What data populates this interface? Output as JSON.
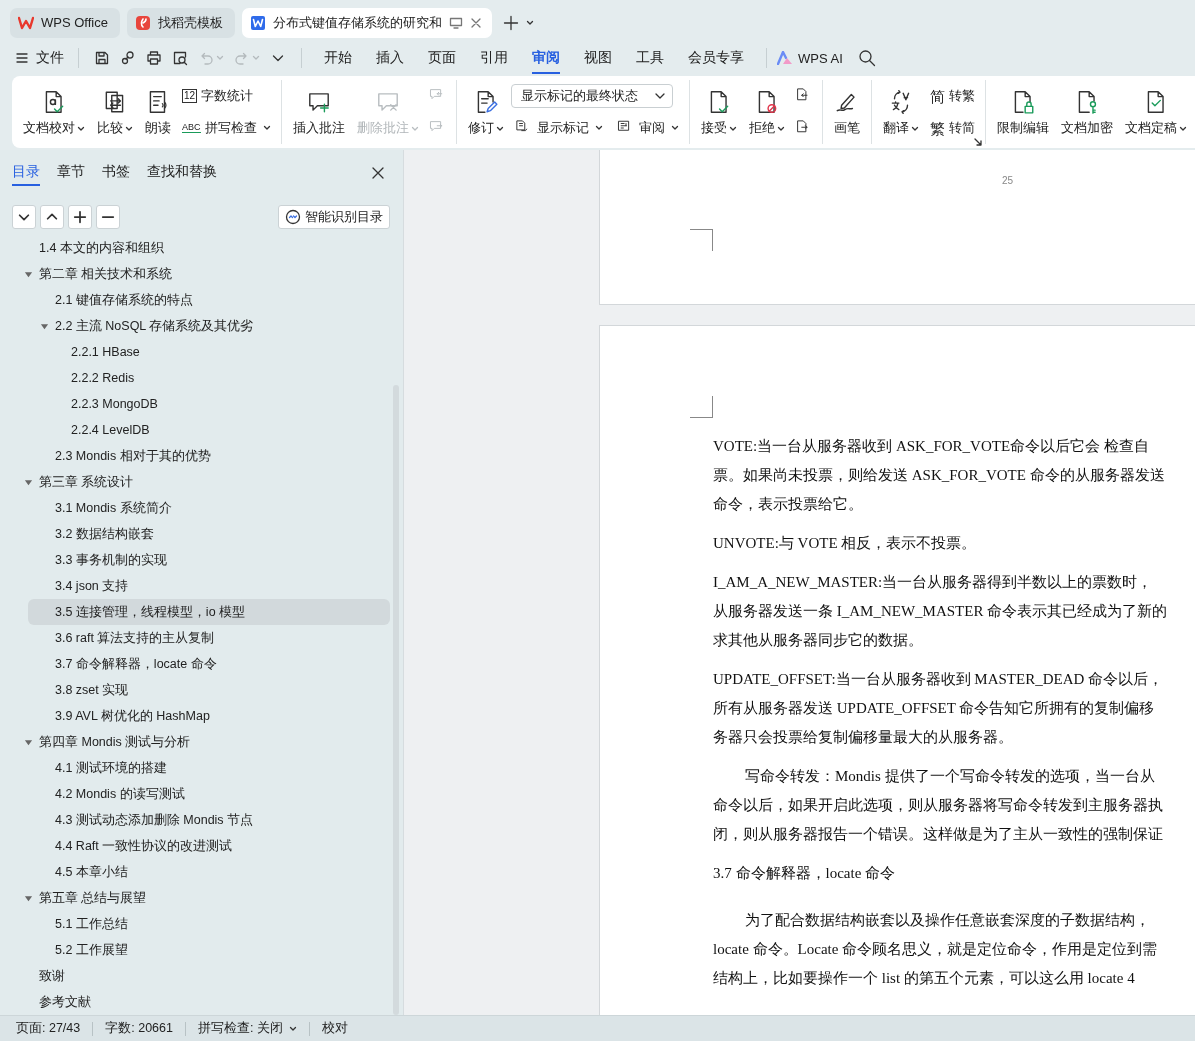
{
  "tab_bar": {
    "tabs": [
      {
        "kind": "home",
        "label": "WPS Office",
        "selected": false
      },
      {
        "kind": "template",
        "label": "找稻壳模板",
        "selected": false
      },
      {
        "kind": "document",
        "label": "分布式键值存储系统的研究和",
        "selected": true
      }
    ]
  },
  "menu_bar": {
    "file_menu": "文件",
    "quick_tools": [
      {
        "kind": "save",
        "disabled": false
      },
      {
        "kind": "link",
        "disabled": false
      },
      {
        "kind": "print",
        "disabled": false
      },
      {
        "kind": "preview",
        "disabled": false
      },
      {
        "kind": "undo",
        "disabled": true
      },
      {
        "kind": "redo",
        "disabled": true
      },
      {
        "kind": "more",
        "disabled": false
      }
    ],
    "tabs": [
      {
        "label": "开始",
        "selected": false
      },
      {
        "label": "插入",
        "selected": false
      },
      {
        "label": "页面",
        "selected": false
      },
      {
        "label": "引用",
        "selected": false
      },
      {
        "label": "审阅",
        "selected": true
      },
      {
        "label": "视图",
        "selected": false
      },
      {
        "label": "工具",
        "selected": false
      },
      {
        "label": "会员专享",
        "selected": false
      }
    ],
    "ai_label": "WPS AI"
  },
  "ribbon": {
    "groups": [
      {
        "columns": [
          {
            "kind": "large",
            "rows": [
              [
                {
                  "kind": "proofread",
                  "label": "文档校对",
                  "dropdown": true,
                  "disabled": false
                }
              ]
            ]
          },
          {
            "kind": "large",
            "rows": [
              [
                {
                  "kind": "compare",
                  "label": "比较",
                  "dropdown": true,
                  "disabled": false
                }
              ]
            ]
          },
          {
            "kind": "large",
            "rows": [
              [
                {
                  "kind": "read",
                  "label": "朗读",
                  "dropdown": false,
                  "disabled": false
                }
              ]
            ]
          },
          {
            "kind": "stack",
            "rows": [
              [
                {
                  "kind": "count",
                  "glyph": "12",
                  "label": "字数统计",
                  "dropdown": false,
                  "disabled": false
                }
              ],
              [
                {
                  "kind": "spell",
                  "glyph": "ABC",
                  "label": "拼写检查",
                  "dropdown": true,
                  "disabled": false
                }
              ]
            ]
          }
        ]
      },
      {
        "columns": [
          {
            "kind": "large",
            "rows": [
              [
                {
                  "kind": "comment",
                  "label": "插入批注",
                  "dropdown": false,
                  "disabled": false
                }
              ]
            ]
          },
          {
            "kind": "large",
            "rows": [
              [
                {
                  "kind": "delete_comment",
                  "label": "删除批注",
                  "dropdown": true,
                  "disabled": true
                }
              ]
            ]
          },
          {
            "kind": "stack",
            "rows": [
              [
                {
                  "kind": "prev_comment",
                  "dropdown": false,
                  "disabled": true
                }
              ],
              [
                {
                  "kind": "next_comment",
                  "dropdown": false,
                  "disabled": true
                }
              ]
            ]
          }
        ]
      },
      {
        "columns": [
          {
            "kind": "large",
            "rows": [
              [
                {
                  "kind": "revise",
                  "label": "修订",
                  "dropdown": true,
                  "disabled": false
                }
              ]
            ]
          },
          {
            "kind": "stack",
            "rows": [
              [
                {
                  "kind": "select",
                  "label": "显示标记的最终状态",
                  "dropdown": true,
                  "disabled": false
                }
              ],
              [
                {
                  "kind": "markup",
                  "label": "显示标记",
                  "dropdown": true,
                  "disabled": false
                },
                {
                  "kind": "review_pane",
                  "label": "审阅",
                  "dropdown": true,
                  "disabled": false
                }
              ]
            ]
          }
        ]
      },
      {
        "columns": [
          {
            "kind": "large",
            "rows": [
              [
                {
                  "kind": "accept",
                  "label": "接受",
                  "dropdown": true,
                  "disabled": false
                }
              ]
            ]
          },
          {
            "kind": "large",
            "rows": [
              [
                {
                  "kind": "reject",
                  "label": "拒绝",
                  "dropdown": true,
                  "disabled": false
                }
              ]
            ]
          },
          {
            "kind": "stack",
            "rows": [
              [
                {
                  "kind": "prev_change",
                  "dropdown": false,
                  "disabled": false
                }
              ],
              [
                {
                  "kind": "next_change",
                  "dropdown": false,
                  "disabled": false
                }
              ]
            ]
          }
        ]
      },
      {
        "columns": [
          {
            "kind": "large",
            "rows": [
              [
                {
                  "kind": "pen",
                  "label": "画笔",
                  "dropdown": false,
                  "disabled": false
                }
              ]
            ]
          }
        ]
      },
      {
        "launcher": true,
        "columns": [
          {
            "kind": "large",
            "rows": [
              [
                {
                  "kind": "translate",
                  "label": "翻译",
                  "dropdown": true,
                  "disabled": false
                }
              ]
            ]
          },
          {
            "kind": "stack",
            "rows": [
              [
                {
                  "kind": "to_traditional",
                  "glyph": "简",
                  "label": "转繁",
                  "dropdown": false,
                  "disabled": false
                }
              ],
              [
                {
                  "kind": "to_simplified",
                  "glyph": "繁",
                  "label": "转简",
                  "dropdown": false,
                  "disabled": false
                }
              ]
            ]
          }
        ]
      },
      {
        "columns": [
          {
            "kind": "large",
            "rows": [
              [
                {
                  "kind": "restrict",
                  "label": "限制编辑",
                  "dropdown": false,
                  "disabled": false
                }
              ]
            ]
          },
          {
            "kind": "large",
            "rows": [
              [
                {
                  "kind": "encrypt",
                  "label": "文档加密",
                  "dropdown": false,
                  "disabled": false
                }
              ]
            ]
          },
          {
            "kind": "large",
            "rows": [
              [
                {
                  "kind": "finalize",
                  "label": "文档定稿",
                  "dropdown": true,
                  "disabled": false
                }
              ]
            ]
          }
        ]
      }
    ]
  },
  "sidebar": {
    "tabs": [
      {
        "label": "目录",
        "selected": true
      },
      {
        "label": "章节",
        "selected": false
      },
      {
        "label": "书签",
        "selected": false
      },
      {
        "label": "查找和替换",
        "selected": false
      }
    ],
    "smart_toc_button": "智能识别目录",
    "toc": [
      {
        "label": "1.4 本文的内容和组织",
        "selected": false
      },
      {
        "label": "第二章  相关技术和系统",
        "selected": false,
        "expanded": true,
        "children": [
          {
            "label": "2.1  键值存储系统的特点",
            "selected": false
          },
          {
            "label": "2.2  主流 NoSQL 存储系统及其优劣",
            "selected": false,
            "expanded": true,
            "children": [
              {
                "label": "2.2.1 HBase",
                "selected": false
              },
              {
                "label": "2.2.2 Redis",
                "selected": false
              },
              {
                "label": "2.2.3 MongoDB",
                "selected": false
              },
              {
                "label": "2.2.4 LevelDB",
                "selected": false
              }
            ]
          },
          {
            "label": "2.3 Mondis 相对于其的优势",
            "selected": false
          }
        ]
      },
      {
        "label": "第三章  系统设计",
        "selected": false,
        "expanded": true,
        "children": [
          {
            "label": "3.1 Mondis 系统简介",
            "selected": false
          },
          {
            "label": "3.2  数据结构嵌套",
            "selected": false
          },
          {
            "label": "3.3  事务机制的实现",
            "selected": false
          },
          {
            "label": "3.4 json 支持",
            "selected": false
          },
          {
            "label": "3.5  连接管理，线程模型，io 模型",
            "selected": true
          },
          {
            "label": "3.6 raft 算法支持的主从复制",
            "selected": false
          },
          {
            "label": "3.7  命令解释器，locate 命令",
            "selected": false
          },
          {
            "label": "3.8 zset 实现",
            "selected": false
          },
          {
            "label": "3.9 AVL 树优化的 HashMap",
            "selected": false
          }
        ]
      },
      {
        "label": "第四章  Mondis 测试与分析",
        "selected": false,
        "expanded": true,
        "children": [
          {
            "label": "4.1  测试环境的搭建",
            "selected": false
          },
          {
            "label": "4.2 Mondis 的读写测试",
            "selected": false
          },
          {
            "label": "4.3  测试动态添加删除 Mondis 节点",
            "selected": false
          },
          {
            "label": "4.4 Raft 一致性协议的改进测试",
            "selected": false
          },
          {
            "label": "4.5  本章小结",
            "selected": false
          }
        ]
      },
      {
        "label": "第五章  总结与展望",
        "selected": false,
        "expanded": true,
        "children": [
          {
            "label": "5.1  工作总结",
            "selected": false
          },
          {
            "label": "5.2  工作展望",
            "selected": false
          }
        ]
      },
      {
        "label": "致谢",
        "selected": false
      },
      {
        "label": "参考文献",
        "selected": false
      }
    ]
  },
  "document": {
    "page_number": "25",
    "blocks": [
      {
        "kind": "paragraph",
        "indent": false,
        "lines": [
          "VOTE:当一台从服务器收到 ASK_FOR_VOTE命令以后它会  检查自",
          "票。如果尚未投票，则给发送 ASK_FOR_VOTE 命令的从服务器发送",
          "命令，表示投票给它。"
        ]
      },
      {
        "kind": "paragraph",
        "indent": false,
        "lines": [
          "UNVOTE:与 VOTE 相反，表示不投票。"
        ]
      },
      {
        "kind": "paragraph",
        "indent": false,
        "lines": [
          "I_AM_A_NEW_MASTER:当一台从服务器得到半数以上的票数时，",
          "从服务器发送一条 I_AM_NEW_MASTER 命令表示其已经成为了新的",
          "求其他从服务器同步它的数据。"
        ]
      },
      {
        "kind": "paragraph",
        "indent": false,
        "lines": [
          "UPDATE_OFFSET:当一台从服务器收到 MASTER_DEAD 命令以后，",
          "所有从服务器发送 UPDATE_OFFSET 命令告知它所拥有的复制偏移",
          "务器只会投票给复制偏移量最大的从服务器。"
        ]
      },
      {
        "kind": "paragraph",
        "indent": true,
        "lines": [
          "写命令转发：Mondis 提供了一个写命令转发的选项，当一台从",
          "命令以后，如果开启此选项，则从服务器将写命令转发到主服务器执",
          "闭，则从服务器报告一个错误。这样做是为了主从一致性的强制保证"
        ]
      },
      {
        "kind": "heading",
        "indent": false,
        "lines": [
          "3.7  命令解释器，locate 命令"
        ]
      },
      {
        "kind": "paragraph",
        "indent": true,
        "lines": [
          "为了配合数据结构嵌套以及操作任意嵌套深度的子数据结构，",
          "locate 命令。Locate 命令顾名思义，就是定位命令，作用是定位到需",
          "结构上，比如要操作一个 list 的第五个元素，可以这么用 locate 4"
        ]
      }
    ]
  },
  "status_bar": {
    "items": [
      {
        "kind": "text",
        "label": "页面: 27/43"
      },
      {
        "kind": "text",
        "label": "字数: 20661"
      },
      {
        "kind": "dropdown",
        "label": "拼写检查: 关闭"
      },
      {
        "kind": "button",
        "label": "校对"
      }
    ]
  }
}
